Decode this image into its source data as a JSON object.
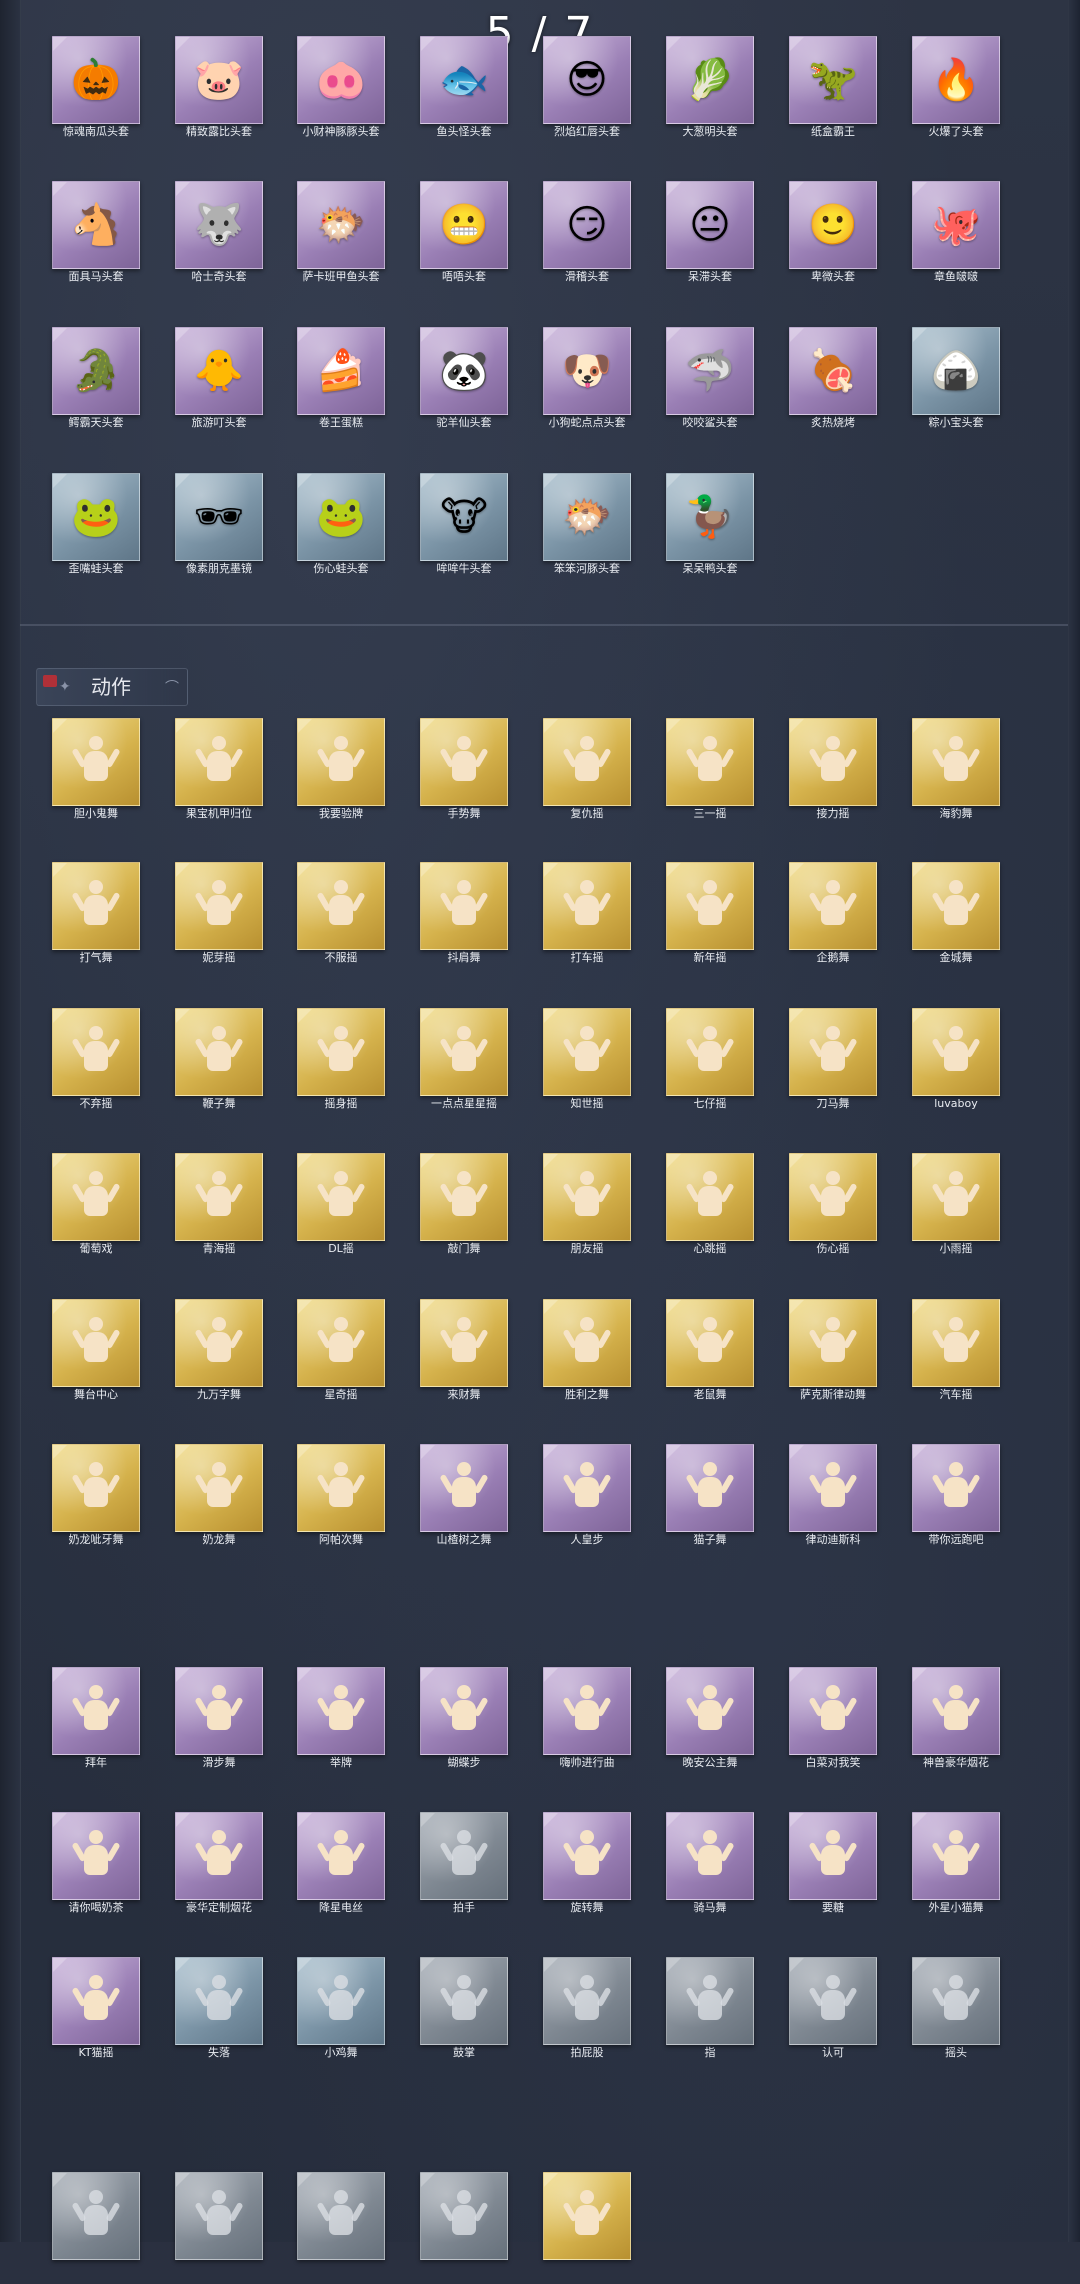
{
  "page_indicator": "5 / 7",
  "section_title": "动作",
  "rarity_colors": {
    "purple": "#9a7fb5",
    "gold": "#d5b24c",
    "blue": "#7b94a6",
    "gray": "#7f8892"
  },
  "headgear": [
    {
      "label": "惊魂南瓜头套",
      "icon": "pumpkin-icon",
      "glyph": "🎃",
      "rarity": "purple"
    },
    {
      "label": "精致露比头套",
      "icon": "pig-icon",
      "glyph": "🐷",
      "rarity": "purple"
    },
    {
      "label": "小财神豚豚头套",
      "icon": "god-pig-icon",
      "glyph": "🐽",
      "rarity": "purple"
    },
    {
      "label": "鱼头怪头套",
      "icon": "fish-monster-icon",
      "glyph": "🐟",
      "rarity": "purple"
    },
    {
      "label": "烈焰红唇头套",
      "icon": "yellow-creature-icon",
      "glyph": "😎",
      "rarity": "purple"
    },
    {
      "label": "大葱明头套",
      "icon": "scallion-icon",
      "glyph": "🥬",
      "rarity": "purple"
    },
    {
      "label": "纸盒霸王",
      "icon": "box-dinosaur-icon",
      "glyph": "🦖",
      "rarity": "purple"
    },
    {
      "label": "火爆了头套",
      "icon": "fire-icon",
      "glyph": "🔥",
      "rarity": "purple"
    },
    {
      "label": "面具马头套",
      "icon": "horse-icon",
      "glyph": "🐴",
      "rarity": "purple"
    },
    {
      "label": "哈士奇头套",
      "icon": "husky-icon",
      "glyph": "🐺",
      "rarity": "purple"
    },
    {
      "label": "萨卡班甲鱼头套",
      "icon": "fish-head-icon",
      "glyph": "🐡",
      "rarity": "purple"
    },
    {
      "label": "唔唔头套",
      "icon": "grimace-icon",
      "glyph": "😬",
      "rarity": "purple"
    },
    {
      "label": "滑稽头套",
      "icon": "smirk-icon",
      "glyph": "😏",
      "rarity": "purple"
    },
    {
      "label": "呆滞头套",
      "icon": "dazed-icon",
      "glyph": "😐",
      "rarity": "purple"
    },
    {
      "label": "卑微头套",
      "icon": "humble-icon",
      "glyph": "🙂",
      "rarity": "purple"
    },
    {
      "label": "章鱼啵啵",
      "icon": "octopus-icon",
      "glyph": "🐙",
      "rarity": "purple"
    },
    {
      "label": "鳄霸天头套",
      "icon": "crocodile-icon",
      "glyph": "🐊",
      "rarity": "purple"
    },
    {
      "label": "旅游叮头套",
      "icon": "tourist-chick-icon",
      "glyph": "🐥",
      "rarity": "purple"
    },
    {
      "label": "卷王蛋糕",
      "icon": "roll-cake-icon",
      "glyph": "🍰",
      "rarity": "purple"
    },
    {
      "label": "驼羊仙头套",
      "icon": "panda-icon",
      "glyph": "🐼",
      "rarity": "purple"
    },
    {
      "label": "小狗蛇点点头套",
      "icon": "snake-dog-icon",
      "glyph": "🐶",
      "rarity": "purple"
    },
    {
      "label": "咬咬鲨头套",
      "icon": "shark-icon",
      "glyph": "🦈",
      "rarity": "purple"
    },
    {
      "label": "炙热烧烤",
      "icon": "bbq-icon",
      "glyph": "🍖",
      "rarity": "purple"
    },
    {
      "label": "粽小宝头套",
      "icon": "zongzi-icon",
      "glyph": "🍙",
      "rarity": "blue"
    },
    {
      "label": "歪嘴蛙头套",
      "icon": "frog-icon",
      "glyph": "🐸",
      "rarity": "blue"
    },
    {
      "label": "像素朋克墨镜",
      "icon": "pixel-sunglasses-icon",
      "glyph": "🕶",
      "rarity": "blue"
    },
    {
      "label": "伤心蛙头套",
      "icon": "sad-frog-icon",
      "glyph": "🐸",
      "rarity": "blue"
    },
    {
      "label": "哞哞牛头套",
      "icon": "cow-icon",
      "glyph": "🐮",
      "rarity": "blue"
    },
    {
      "label": "笨笨河豚头套",
      "icon": "pufferfish-icon",
      "glyph": "🐡",
      "rarity": "blue"
    },
    {
      "label": "呆呆鸭头套",
      "icon": "duck-icon",
      "glyph": "🦆",
      "rarity": "blue"
    }
  ],
  "actions_group_1": [
    {
      "label": "胆小鬼舞",
      "icon": "dance-icon",
      "rarity": "gold"
    },
    {
      "label": "果宝机甲归位",
      "icon": "dance-icon",
      "rarity": "gold"
    },
    {
      "label": "我要验牌",
      "icon": "dance-icon",
      "rarity": "gold"
    },
    {
      "label": "手势舞",
      "icon": "dance-icon",
      "rarity": "gold"
    },
    {
      "label": "复仇摇",
      "icon": "dance-icon",
      "rarity": "gold"
    },
    {
      "label": "三一摇",
      "icon": "dance-icon",
      "rarity": "gold"
    },
    {
      "label": "接力摇",
      "icon": "dance-icon",
      "rarity": "gold"
    },
    {
      "label": "海豹舞",
      "icon": "dance-icon",
      "rarity": "gold"
    },
    {
      "label": "打气舞",
      "icon": "dance-icon",
      "rarity": "gold"
    },
    {
      "label": "妮芽摇",
      "icon": "dance-icon",
      "rarity": "gold"
    },
    {
      "label": "不服摇",
      "icon": "dance-icon",
      "rarity": "gold"
    },
    {
      "label": "抖肩舞",
      "icon": "dance-icon",
      "rarity": "gold"
    },
    {
      "label": "打车摇",
      "icon": "dance-icon",
      "rarity": "gold"
    },
    {
      "label": "新年摇",
      "icon": "dance-icon",
      "rarity": "gold"
    },
    {
      "label": "企鹅舞",
      "icon": "dance-icon",
      "rarity": "gold"
    },
    {
      "label": "金城舞",
      "icon": "dance-icon",
      "rarity": "gold"
    },
    {
      "label": "不弃摇",
      "icon": "dance-icon",
      "rarity": "gold"
    },
    {
      "label": "鞭子舞",
      "icon": "dance-icon",
      "rarity": "gold"
    },
    {
      "label": "摇身摇",
      "icon": "dance-icon",
      "rarity": "gold"
    },
    {
      "label": "一点点星星摇",
      "icon": "dance-icon",
      "rarity": "gold"
    },
    {
      "label": "知世摇",
      "icon": "dance-icon",
      "rarity": "gold"
    },
    {
      "label": "七仔摇",
      "icon": "dance-icon",
      "rarity": "gold"
    },
    {
      "label": "刀马舞",
      "icon": "dance-icon",
      "rarity": "gold"
    },
    {
      "label": "luvaboy",
      "icon": "dance-icon",
      "rarity": "gold"
    },
    {
      "label": "葡萄戏",
      "icon": "dance-icon",
      "rarity": "gold"
    },
    {
      "label": "青海摇",
      "icon": "dance-icon",
      "rarity": "gold"
    },
    {
      "label": "DL摇",
      "icon": "dance-icon",
      "rarity": "gold"
    },
    {
      "label": "敲门舞",
      "icon": "dance-icon",
      "rarity": "gold"
    },
    {
      "label": "朋友摇",
      "icon": "dance-icon",
      "rarity": "gold"
    },
    {
      "label": "心跳摇",
      "icon": "dance-icon",
      "rarity": "gold"
    },
    {
      "label": "伤心摇",
      "icon": "dance-icon",
      "rarity": "gold"
    },
    {
      "label": "小雨摇",
      "icon": "dance-icon",
      "rarity": "gold"
    },
    {
      "label": "舞台中心",
      "icon": "dance-icon",
      "rarity": "gold"
    },
    {
      "label": "九万字舞",
      "icon": "dance-icon",
      "rarity": "gold"
    },
    {
      "label": "星奇摇",
      "icon": "dance-icon",
      "rarity": "gold"
    },
    {
      "label": "来财舞",
      "icon": "dance-icon",
      "rarity": "gold"
    },
    {
      "label": "胜利之舞",
      "icon": "dance-icon",
      "rarity": "gold"
    },
    {
      "label": "老鼠舞",
      "icon": "dance-icon",
      "rarity": "gold"
    },
    {
      "label": "萨克斯律动舞",
      "icon": "dance-icon",
      "rarity": "gold"
    },
    {
      "label": "汽车摇",
      "icon": "dance-icon",
      "rarity": "gold"
    },
    {
      "label": "奶龙呲牙舞",
      "icon": "dance-icon",
      "rarity": "gold"
    },
    {
      "label": "奶龙舞",
      "icon": "dance-icon",
      "rarity": "gold"
    },
    {
      "label": "阿帕次舞",
      "icon": "dance-icon",
      "rarity": "gold"
    },
    {
      "label": "山楂树之舞",
      "icon": "dance-icon",
      "rarity": "purple"
    },
    {
      "label": "人皇步",
      "icon": "dance-icon",
      "rarity": "purple"
    },
    {
      "label": "猫子舞",
      "icon": "dance-icon",
      "rarity": "purple"
    },
    {
      "label": "律动迪斯科",
      "icon": "dance-icon",
      "rarity": "purple"
    },
    {
      "label": "带你远跑吧",
      "icon": "dance-icon",
      "rarity": "purple"
    }
  ],
  "actions_group_2": [
    {
      "label": "拜年",
      "icon": "dance-icon",
      "rarity": "purple"
    },
    {
      "label": "滑步舞",
      "icon": "dance-icon",
      "rarity": "purple"
    },
    {
      "label": "举牌",
      "icon": "sign-icon",
      "rarity": "purple"
    },
    {
      "label": "蝴蝶步",
      "icon": "dance-icon",
      "rarity": "purple"
    },
    {
      "label": "嗨帅进行曲",
      "icon": "dance-icon",
      "rarity": "purple"
    },
    {
      "label": "晚安公主舞",
      "icon": "dance-icon",
      "rarity": "purple"
    },
    {
      "label": "白菜对我笑",
      "icon": "dance-icon",
      "rarity": "purple"
    },
    {
      "label": "神兽豪华烟花",
      "icon": "fireworks-icon",
      "rarity": "purple"
    },
    {
      "label": "请你喝奶茶",
      "icon": "dance-icon",
      "rarity": "purple"
    },
    {
      "label": "豪华定制烟花",
      "icon": "fireworks-icon",
      "rarity": "purple"
    },
    {
      "label": "降星电丝",
      "icon": "dance-icon",
      "rarity": "purple"
    },
    {
      "label": "拍手",
      "icon": "dance-icon",
      "rarity": "gray"
    },
    {
      "label": "旋转舞",
      "icon": "dance-icon",
      "rarity": "purple"
    },
    {
      "label": "骑马舞",
      "icon": "dance-icon",
      "rarity": "purple"
    },
    {
      "label": "要糖",
      "icon": "dance-icon",
      "rarity": "purple"
    },
    {
      "label": "外星小猫舞",
      "icon": "dance-icon",
      "rarity": "purple"
    },
    {
      "label": "KT猫摇",
      "icon": "dance-icon",
      "rarity": "purple"
    },
    {
      "label": "失落",
      "icon": "dance-icon",
      "rarity": "blue"
    },
    {
      "label": "小鸡舞",
      "icon": "dance-icon",
      "rarity": "blue"
    },
    {
      "label": "鼓掌",
      "icon": "dance-icon",
      "rarity": "gray"
    },
    {
      "label": "拍屁股",
      "icon": "dance-icon",
      "rarity": "gray"
    },
    {
      "label": "指",
      "icon": "dance-icon",
      "rarity": "gray"
    },
    {
      "label": "认可",
      "icon": "dance-icon",
      "rarity": "gray"
    },
    {
      "label": "摇头",
      "icon": "dance-icon",
      "rarity": "gray"
    }
  ],
  "actions_partial_row": [
    {
      "label": "",
      "icon": "dance-icon",
      "rarity": "gray"
    },
    {
      "label": "",
      "icon": "dance-icon",
      "rarity": "gray"
    },
    {
      "label": "",
      "icon": "dance-icon",
      "rarity": "gray"
    },
    {
      "label": "",
      "icon": "fireworks-icon",
      "rarity": "gray"
    },
    {
      "label": "",
      "icon": "dance-icon",
      "rarity": "gold"
    }
  ]
}
